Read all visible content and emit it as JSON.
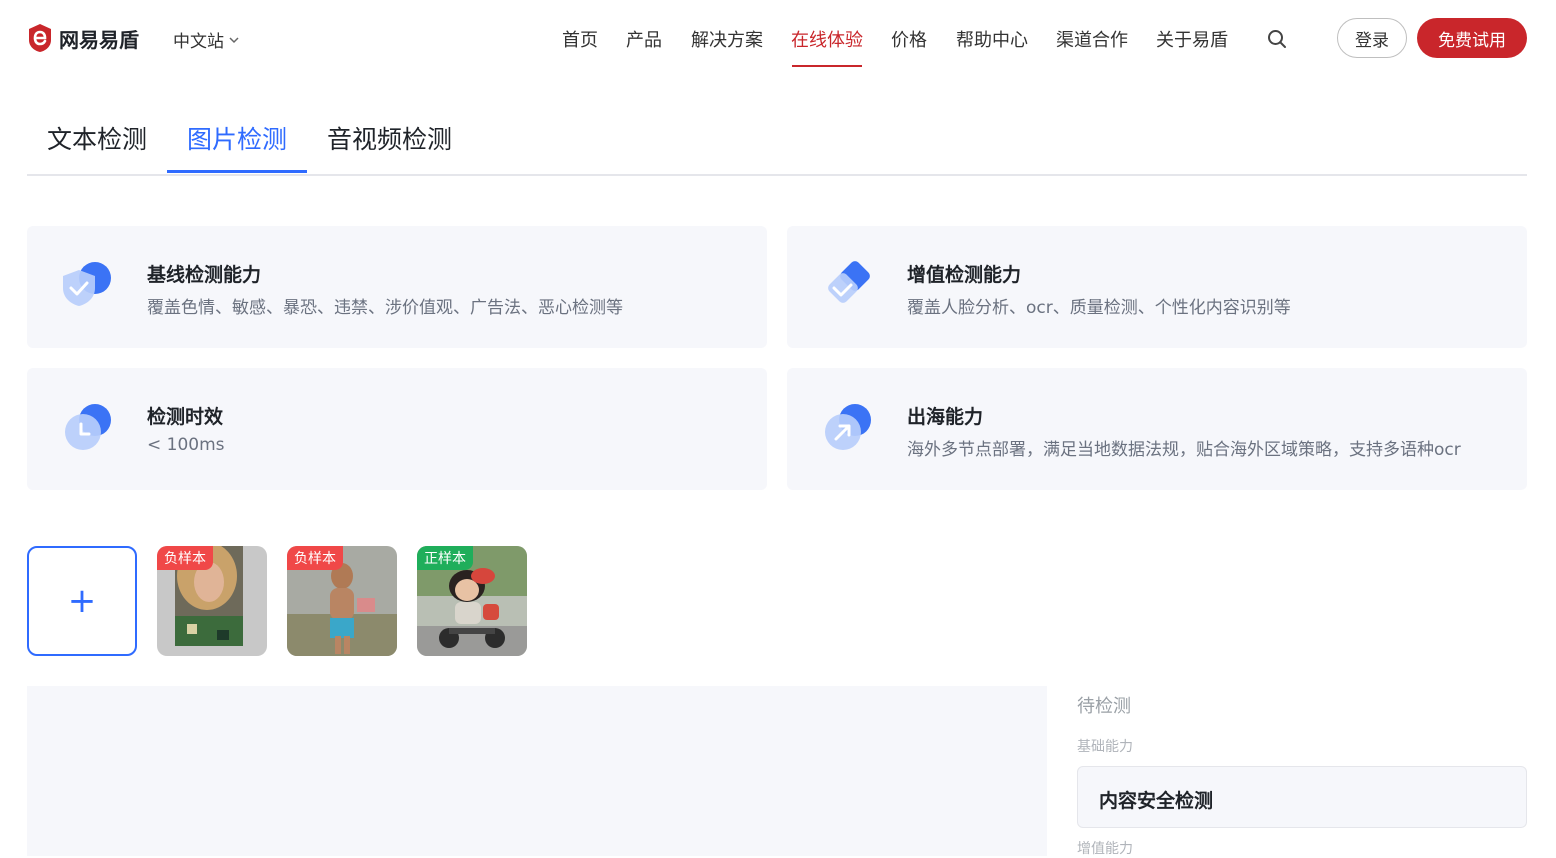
{
  "header": {
    "logo_text": "网易易盾",
    "lang_label": "中文站",
    "nav": [
      "首页",
      "产品",
      "解决方案",
      "在线体验",
      "价格",
      "帮助中心",
      "渠道合作",
      "关于易盾"
    ],
    "active_nav": "在线体验",
    "login_label": "登录",
    "trial_label": "免费试用",
    "brand_color": "#c9262b"
  },
  "tabs": {
    "items": [
      "文本检测",
      "图片检测",
      "音视频检测"
    ],
    "active": "图片检测",
    "accent_color": "#2f6bff"
  },
  "features": [
    {
      "icon": "shield-check-icon",
      "title": "基线检测能力",
      "desc": "覆盖色情、敏感、暴恐、违禁、涉价值观、广告法、恶心检测等"
    },
    {
      "icon": "diamond-check-icon",
      "title": "增值检测能力",
      "desc": "覆盖人脸分析、ocr、质量检测、个性化内容识别等"
    },
    {
      "icon": "clock-icon",
      "title": "检测时效",
      "desc": "< 100ms"
    },
    {
      "icon": "arrow-up-right-icon",
      "title": "出海能力",
      "desc": "海外多节点部署，满足当地数据法规，贴合海外区域策略，支持多语种ocr"
    }
  ],
  "samples": {
    "upload_icon": "+",
    "items": [
      {
        "badge": "负样本",
        "kind": "negative"
      },
      {
        "badge": "负样本",
        "kind": "negative"
      },
      {
        "badge": "正样本",
        "kind": "positive"
      }
    ]
  },
  "result": {
    "status": "待检测",
    "section_label": "基础能力",
    "item_label": "内容安全检测",
    "next_label": "增值能力"
  }
}
